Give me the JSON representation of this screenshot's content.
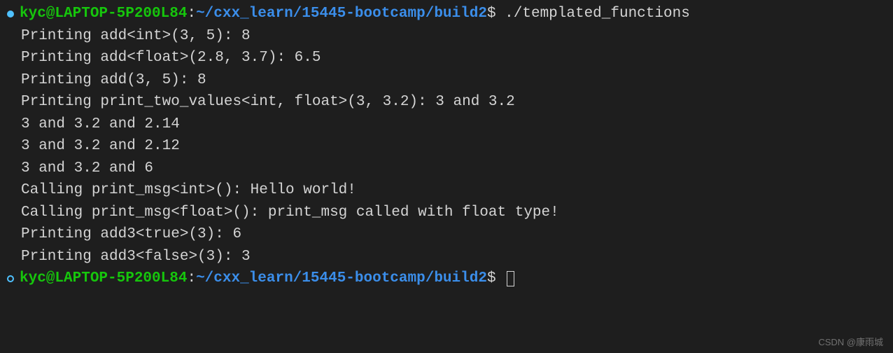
{
  "prompt1": {
    "user_host": "kyc@LAPTOP-5P200L84",
    "colon": ":",
    "path": "~/cxx_learn/15445-bootcamp/build2",
    "dollar": "$ ",
    "command": "./templated_functions"
  },
  "output_lines": [
    "Printing add<int>(3, 5): 8",
    "Printing add<float>(2.8, 3.7): 6.5",
    "Printing add(3, 5): 8",
    "Printing print_two_values<int, float>(3, 3.2): 3 and 3.2",
    "3 and 3.2 and 2.14",
    "3 and 3.2 and 2.12",
    "3 and 3.2 and 6",
    "Calling print_msg<int>(): Hello world!",
    "Calling print_msg<float>(): print_msg called with float type!",
    "Printing add3<true>(3): 6",
    "Printing add3<false>(3): 3"
  ],
  "prompt2": {
    "user_host": "kyc@LAPTOP-5P200L84",
    "colon": ":",
    "path": "~/cxx_learn/15445-bootcamp/build2",
    "dollar": "$ "
  },
  "watermark": "CSDN @康雨城"
}
